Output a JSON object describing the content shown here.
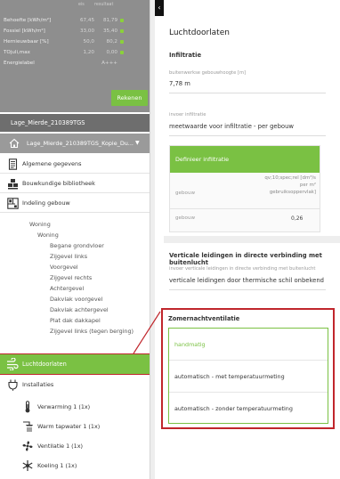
{
  "stats": {
    "col_headers": [
      "eis",
      "resultaat"
    ],
    "rows": [
      {
        "label": "Behoefte [kWh/m²]",
        "v1": "67,45",
        "v2": "81,79"
      },
      {
        "label": "Fossiel [kWh/m²]",
        "v1": "33,00",
        "v2": "35,40"
      },
      {
        "label": "Hernieuwbaar [%]",
        "v1": "50,0",
        "v2": "80,2"
      },
      {
        "label": "TOjuli,max",
        "v1": "1,20",
        "v2": "0,00"
      },
      {
        "label": "Energielabel",
        "v1": "",
        "v2": "A+++"
      }
    ],
    "rekenen_label": "Rekenen"
  },
  "project": {
    "title": "Lage_Mierde_210389TGS",
    "selected": "Lage_Mierde_210389TGS_Kopie_Du..."
  },
  "nav": {
    "main": [
      {
        "label": "Algemene gegevens",
        "icon": "document-icon"
      },
      {
        "label": "Bouwkundige bibliotheek",
        "icon": "building-blocks-icon"
      },
      {
        "label": "Indeling gebouw",
        "icon": "floorplan-icon"
      }
    ],
    "tree_level1": "Woning",
    "tree_level2": "Woning",
    "tree_items": [
      "Begane grondvloer",
      "Zijgevel links",
      "Voorgevel",
      "Zijgevel rechts",
      "Achtergevel",
      "Dakvlak voorgevel",
      "Dakvlak achtergevel",
      "Plat dak dakkapel",
      "Zijgevel links (tegen berging)"
    ],
    "active": {
      "label": "Luchtdoorlaten",
      "icon": "wind-icon"
    },
    "installaties": {
      "label": "Installaties",
      "icon": "plug-icon"
    },
    "sub": [
      {
        "label": "Verwarming 1 (1x)",
        "icon": "thermometer-icon"
      },
      {
        "label": "Warm tapwater 1 (1x)",
        "icon": "shower-icon"
      },
      {
        "label": "Ventilatie 1 (1x)",
        "icon": "fan-icon"
      },
      {
        "label": "Koeling 1 (1x)",
        "icon": "snowflake-icon"
      }
    ]
  },
  "main": {
    "title": "Luchtdoorlaten",
    "infiltratie": {
      "title": "Infiltratie",
      "height_label": "buitenwerkse gebouwhoogte [m]",
      "height_value": "7,78  m",
      "invoer_label": "invoer infiltratie",
      "invoer_value": "meetwaarde voor infiltratie - per gebouw"
    },
    "table": {
      "header": "Definieer infiltratie",
      "col1": "gebouw",
      "col2_lines": [
        "qv;10;spec;rel [dm³/s",
        "per m²",
        "gebruiksoppervlak]"
      ],
      "row_label": "gebouw",
      "row_value": "0,26"
    },
    "leidingen": {
      "title": "Verticale leidingen in directe verbinding met buitenlucht",
      "label": "invoer verticale leidingen in directe verbinding met buitenlucht",
      "value": "verticale leidingen door thermische schil onbekend"
    },
    "zomer": {
      "title": "Zomernachtventilatie",
      "options": [
        "handmatig",
        "automatisch - met temperatuurmeting",
        "automatisch - zonder temperatuurmeting"
      ],
      "selected_index": 0
    }
  },
  "colors": {
    "accent": "#7ac143",
    "highlight": "#c0262c",
    "sidebar_dark": "#6e6e6e"
  }
}
